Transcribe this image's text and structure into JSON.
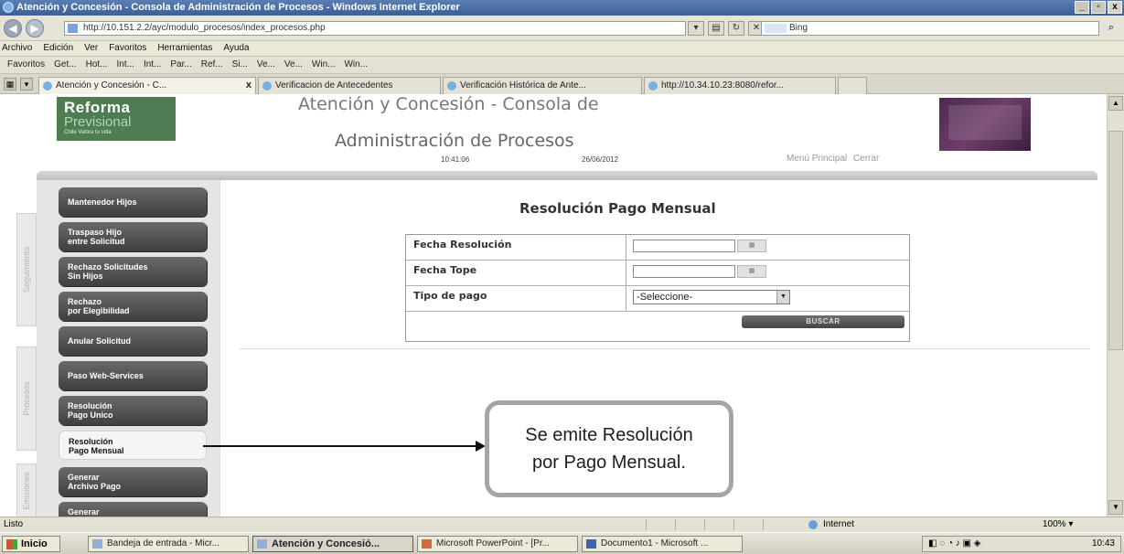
{
  "window": {
    "title": "Atención y Concesión - Consola de Administración de Procesos - Windows Internet Explorer",
    "controls": [
      "_",
      "▫",
      "x"
    ]
  },
  "address_bar": {
    "url": "http://10.151.2.2/ayc/modulo_procesos/index_procesos.php",
    "search_placeholder": "Bing"
  },
  "menu": [
    "Archivo",
    "Edición",
    "Ver",
    "Favoritos",
    "Herramientas",
    "Ayuda"
  ],
  "favorites": {
    "label": "Favoritos",
    "items": [
      "Get...",
      "Hot...",
      "Int...",
      "Int...",
      "Par...",
      "Ref...",
      "Si...",
      "Ve...",
      "Ve...",
      "Win...",
      "Win..."
    ]
  },
  "tabs": [
    {
      "label": "Atención y Concesión - C...",
      "active": true
    },
    {
      "label": "Verificacion de Antecedentes",
      "active": false
    },
    {
      "label": "Verificación Histórica de Ante...",
      "active": false
    },
    {
      "label": "http://10.34.10.23:8080/refor...",
      "active": false
    }
  ],
  "page_header": {
    "logo_line1": "Reforma",
    "logo_line2": "Previsional",
    "logo_line3": "Chile Valora tu vida",
    "title_line1": "Atención y Concesión - Consola de",
    "title_line2": "Administración de Procesos",
    "time": "10:41:06",
    "date": "26/06/2012",
    "menu_principal": "Menú Principal",
    "cerrar": "Cerrar"
  },
  "side_tabs": [
    "Seguimiento",
    "Procesos",
    "Emisiones"
  ],
  "nav": [
    {
      "line1": "Mantenedor Hijos",
      "line2": ""
    },
    {
      "line1": "Traspaso Hijo",
      "line2": "entre Solicitud"
    },
    {
      "line1": "Rechazo Solicitudes",
      "line2": "Sin Hijos"
    },
    {
      "line1": "Rechazo",
      "line2": "por Elegibilidad"
    },
    {
      "line1": "Anular Solicitud",
      "line2": ""
    },
    {
      "line1": "Paso Web-Services",
      "line2": ""
    },
    {
      "line1": "Resolución",
      "line2": "Pago Unico"
    },
    {
      "line1": "Resolución",
      "line2": "Pago Mensual"
    },
    {
      "line1": "Generar",
      "line2": "Archivo Pago"
    },
    {
      "line1": "Generar",
      "line2": ""
    }
  ],
  "form": {
    "title": "Resolución Pago Mensual",
    "fecha_resolucion_label": "Fecha Resolución",
    "fecha_tope_label": "Fecha Tope",
    "tipo_pago_label": "Tipo de pago",
    "tipo_pago_value": "-Seleccione-",
    "buscar_label": "BUSCAR"
  },
  "callout": {
    "line1": "Se emite Resolución",
    "line2": "por Pago Mensual."
  },
  "status_bar": {
    "left": "Listo",
    "zone": "Internet",
    "zoom": "100%"
  },
  "taskbar": {
    "start": "Inicio",
    "items": [
      {
        "label": "Bandeja de entrada - Micr...",
        "active": false
      },
      {
        "label": "Atención y Concesió...",
        "active": true
      },
      {
        "label": "Microsoft PowerPoint - [Pr...",
        "active": false
      },
      {
        "label": "Documento1 - Microsoft ...",
        "active": false
      }
    ],
    "clock": "10:43"
  }
}
